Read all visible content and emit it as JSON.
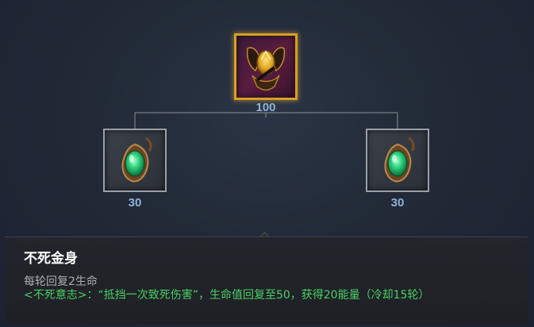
{
  "tree": {
    "top_item": {
      "icon": "golden-winged-crest-icon",
      "cost": "100"
    },
    "left_item": {
      "icon": "green-gem-amulet-icon",
      "cost": "30"
    },
    "right_item": {
      "icon": "green-gem-amulet-icon",
      "cost": "30"
    }
  },
  "details": {
    "name": "不死金身",
    "stat": "每轮回复2生命",
    "passive": "<不死意志>：“抵挡一次致死伤害”，生命值回复至50，获得20能量（冷却15轮）"
  },
  "colors": {
    "cost_text": "#8fb1d8",
    "top_border": "#d89f20",
    "passive_text": "#49d064"
  }
}
